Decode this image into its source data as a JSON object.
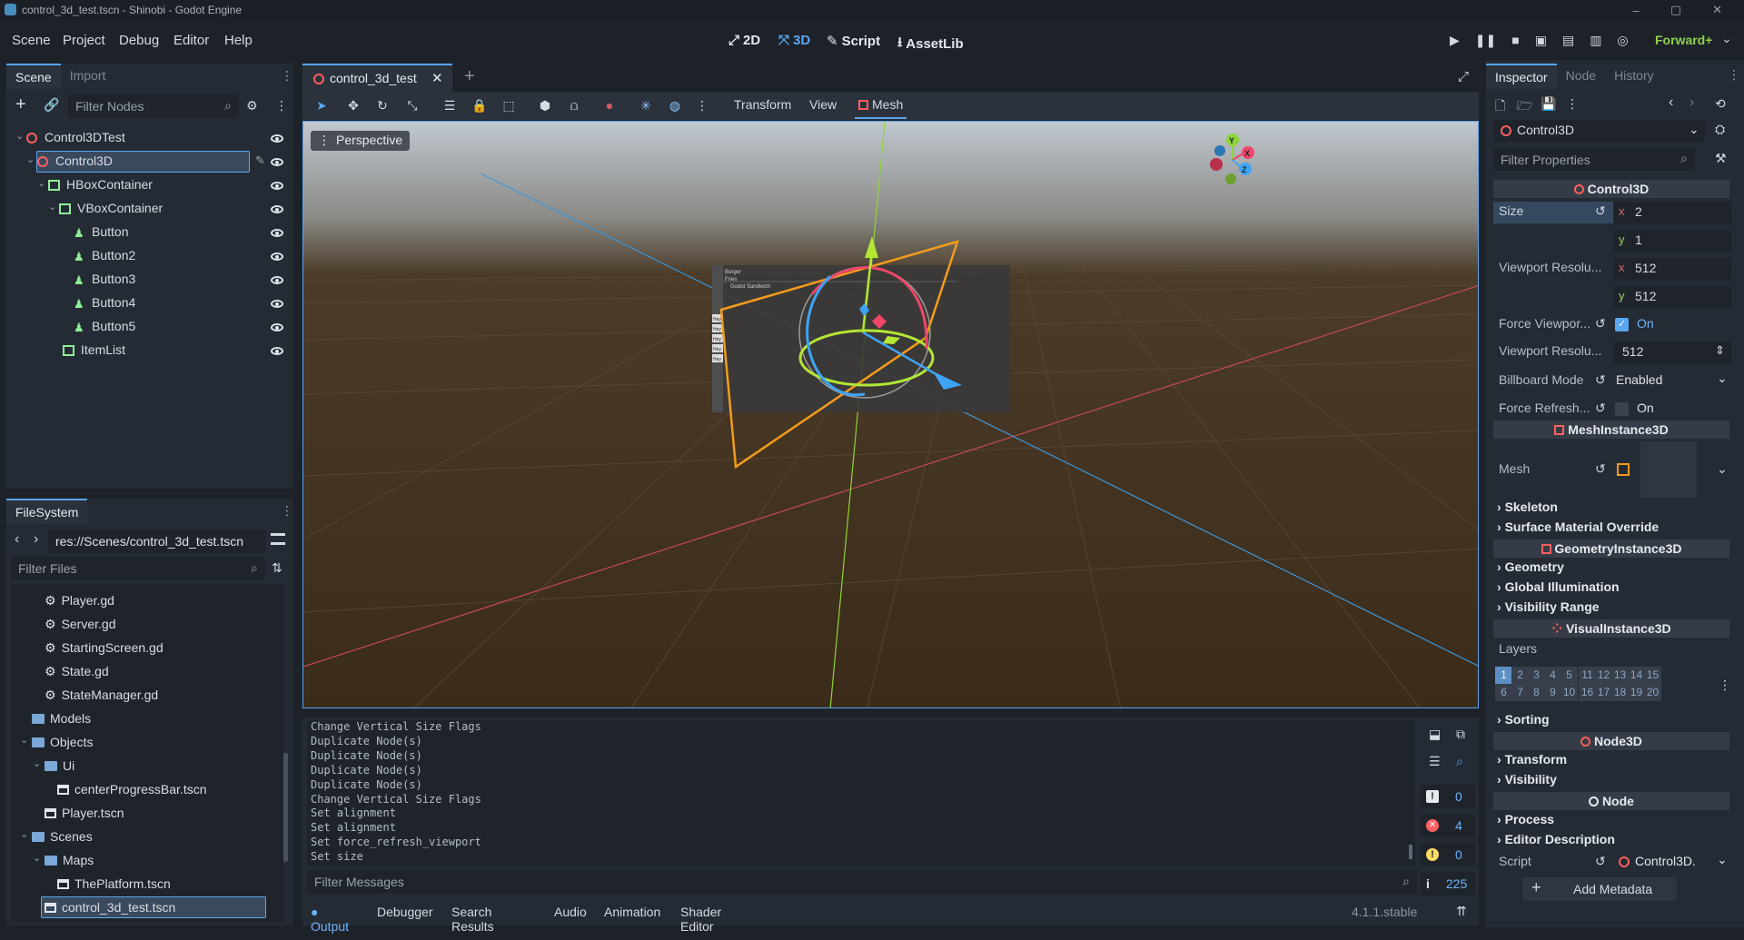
{
  "window": {
    "title": "control_3d_test.tscn - Shinobi - Godot Engine"
  },
  "menu": {
    "items": [
      "Scene",
      "Project",
      "Debug",
      "Editor",
      "Help"
    ]
  },
  "modes": {
    "two_d": "2D",
    "three_d": "3D",
    "script": "Script",
    "assetlib": "AssetLib"
  },
  "renderer": "Forward+",
  "scene_dock": {
    "tabs": [
      "Scene",
      "Import"
    ],
    "filter_placeholder": "Filter Nodes",
    "nodes": [
      {
        "label": "Control3DTest",
        "icon": "control3d-icon"
      },
      {
        "label": "Control3D",
        "icon": "control3d-icon",
        "selected": true
      },
      {
        "label": "HBoxContainer",
        "icon": "hbox-icon"
      },
      {
        "label": "VBoxContainer",
        "icon": "vbox-icon"
      },
      {
        "label": "Button",
        "icon": "button-icon"
      },
      {
        "label": "Button2",
        "icon": "button-icon"
      },
      {
        "label": "Button3",
        "icon": "button-icon"
      },
      {
        "label": "Button4",
        "icon": "button-icon"
      },
      {
        "label": "Button5",
        "icon": "button-icon"
      },
      {
        "label": "ItemList",
        "icon": "itemlist-icon"
      }
    ]
  },
  "filesystem": {
    "tab": "FileSystem",
    "path": "res://Scenes/control_3d_test.tscn",
    "filter_placeholder": "Filter Files",
    "entries": [
      {
        "label": "Player.gd",
        "type": "script"
      },
      {
        "label": "Server.gd",
        "type": "script"
      },
      {
        "label": "StartingScreen.gd",
        "type": "script"
      },
      {
        "label": "State.gd",
        "type": "script"
      },
      {
        "label": "StateManager.gd",
        "type": "script"
      },
      {
        "label": "Models",
        "type": "folder"
      },
      {
        "label": "Objects",
        "type": "folder"
      },
      {
        "label": "Ui",
        "type": "folder"
      },
      {
        "label": "centerProgressBar.tscn",
        "type": "scene"
      },
      {
        "label": "Player.tscn",
        "type": "scene"
      },
      {
        "label": "Scenes",
        "type": "folder"
      },
      {
        "label": "Maps",
        "type": "folder"
      },
      {
        "label": "ThePlatform.tscn",
        "type": "scene"
      },
      {
        "label": "control_3d_test.tscn",
        "type": "scene",
        "selected": true
      }
    ]
  },
  "editor_tab": {
    "label": "control_3d_test"
  },
  "viewport_toolbar": {
    "transform": "Transform",
    "view": "View",
    "mesh": "Mesh"
  },
  "viewport": {
    "perspective": "Perspective",
    "embedded_ui": {
      "items": [
        "Burger",
        "Fries",
        "Godot Sandwich"
      ],
      "buttons": [
        "Hey",
        "Hey",
        "Hey",
        "Hey",
        "Hey"
      ]
    },
    "gizmo_axes": [
      "Y",
      "X",
      "Z"
    ]
  },
  "output": {
    "lines": [
      "Change Vertical Size Flags",
      "Duplicate Node(s)",
      "Duplicate Node(s)",
      "Duplicate Node(s)",
      "Duplicate Node(s)",
      "Change Vertical Size Flags",
      "Set alignment",
      "Set alignment",
      "Set force_refresh_viewport",
      "Set size"
    ],
    "filter_placeholder": "Filter Messages",
    "counts": {
      "messages": "0",
      "errors": "4",
      "warnings": "0",
      "info": "225"
    },
    "version": "4.1.1.stable"
  },
  "bottom_tabs": [
    "Output",
    "Debugger",
    "Search Results",
    "Audio",
    "Animation",
    "Shader Editor"
  ],
  "inspector": {
    "tabs": [
      "Inspector",
      "Node",
      "History"
    ],
    "node_name": "Control3D",
    "filter_placeholder": "Filter Properties",
    "sections": {
      "control3d": "Control3D",
      "meshinstance3d": "MeshInstance3D",
      "geometryinstance3d": "GeometryInstance3D",
      "visualinstance3d": "VisualInstance3D",
      "node3d": "Node3D",
      "node": "Node"
    },
    "props": {
      "size_label": "Size",
      "size_x": "2",
      "size_y": "1",
      "vp_res_label": "Viewport Resolu...",
      "vp_res_x": "512",
      "vp_res_y": "512",
      "force_vp_label": "Force Viewpor...",
      "force_vp_value": "On",
      "vp_res2_label": "Viewport Resolu...",
      "vp_res2_value": "512",
      "billboard_label": "Billboard Mode",
      "billboard_value": "Enabled",
      "force_refresh_label": "Force Refresh...",
      "force_refresh_value": "On",
      "mesh_label": "Mesh",
      "layers_label": "Layers",
      "script_label": "Script",
      "script_value": "Control3D."
    },
    "subsections": {
      "skeleton": "Skeleton",
      "surface_material": "Surface Material Override",
      "geometry": "Geometry",
      "global_illumination": "Global Illumination",
      "visibility_range": "Visibility Range",
      "sorting": "Sorting",
      "transform": "Transform",
      "visibility": "Visibility",
      "process": "Process",
      "editor_description": "Editor Description"
    },
    "layers_row1": [
      "1",
      "2",
      "3",
      "4",
      "5",
      "11",
      "12",
      "13",
      "14",
      "15"
    ],
    "layers_row2": [
      "6",
      "7",
      "8",
      "9",
      "10",
      "16",
      "17",
      "18",
      "19",
      "20"
    ],
    "add_metadata": "Add Metadata"
  },
  "colors": {
    "accent": "#5aa6f0",
    "node_red": "#ff5f5f",
    "control_green": "#8eef97",
    "bg": "#1d2229"
  }
}
